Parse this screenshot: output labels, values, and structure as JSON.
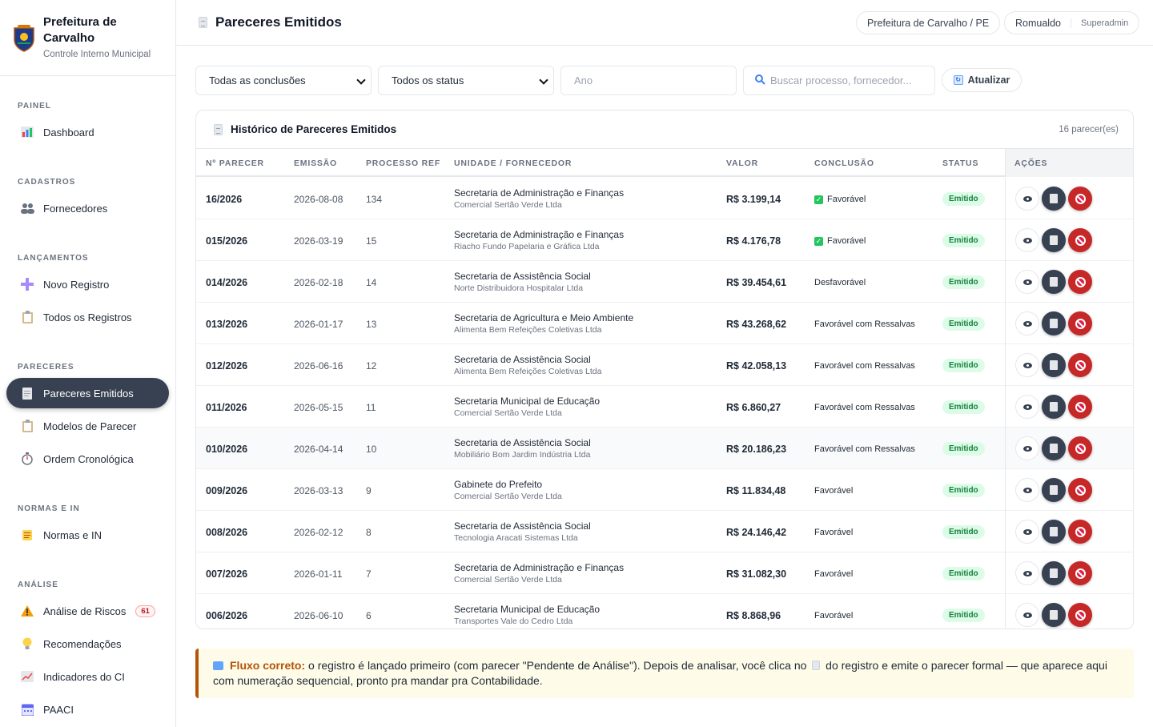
{
  "brand": {
    "title": "Prefeitura de Carvalho",
    "subtitle": "Controle Interno Municipal"
  },
  "sidebar": {
    "sections": [
      {
        "label": "PAINEL"
      },
      {
        "label": "CADASTROS"
      },
      {
        "label": "LANÇAMENTOS"
      },
      {
        "label": "PARECERES"
      },
      {
        "label": "NORMAS E IN"
      },
      {
        "label": "ANÁLISE"
      }
    ],
    "items": [
      {
        "label": "Dashboard",
        "icon": "bar-chart-icon"
      },
      {
        "label": "Fornecedores",
        "icon": "users-icon"
      },
      {
        "label": "Novo Registro",
        "icon": "plus-icon"
      },
      {
        "label": "Todos os Registros",
        "icon": "clipboard-icon"
      },
      {
        "label": "Pareceres Emitidos",
        "icon": "document-icon",
        "active": true
      },
      {
        "label": "Modelos de Parecer",
        "icon": "clipboard-icon"
      },
      {
        "label": "Ordem Cronológica",
        "icon": "stopwatch-icon"
      },
      {
        "label": "Normas e IN",
        "icon": "scroll-icon"
      },
      {
        "label": "Análise de Riscos",
        "icon": "warning-icon",
        "badge": "61"
      },
      {
        "label": "Recomendações",
        "icon": "lightbulb-icon"
      },
      {
        "label": "Indicadores do CI",
        "icon": "trend-chart-icon"
      },
      {
        "label": "PAACI",
        "icon": "calendar-icon"
      }
    ]
  },
  "header": {
    "title": "Pareceres Emitidos",
    "org": "Prefeitura de Carvalho / PE",
    "user": "Romualdo",
    "role": "Superadmin"
  },
  "filters": {
    "conclusion": "Todas as conclusões",
    "status": "Todos os status",
    "year_placeholder": "Ano",
    "search_placeholder": "Buscar processo, fornecedor...",
    "refresh_label": "Atualizar"
  },
  "table": {
    "title": "Histórico de Pareceres Emitidos",
    "count": "16 parecer(es)",
    "columns": [
      "Nº PARECER",
      "EMISSÃO",
      "PROCESSO REF",
      "UNIDADE / FORNECEDOR",
      "VALOR",
      "CONCLUSÃO",
      "STATUS",
      "AÇÕES"
    ],
    "rows": [
      {
        "numero": "16/2026",
        "emissao": "2026-08-08",
        "processo": "134",
        "unidade": "Secretaria de Administração e Finanças",
        "fornecedor": "Comercial Sertão Verde Ltda",
        "valor": "R$ 3.199,14",
        "conclusao": "Favorável",
        "check": true,
        "status": "Emitido"
      },
      {
        "numero": "015/2026",
        "emissao": "2026-03-19",
        "processo": "15",
        "unidade": "Secretaria de Administração e Finanças",
        "fornecedor": "Riacho Fundo Papelaria e Gráfica Ltda",
        "valor": "R$ 4.176,78",
        "conclusao": "Favorável",
        "check": true,
        "status": "Emitido"
      },
      {
        "numero": "014/2026",
        "emissao": "2026-02-18",
        "processo": "14",
        "unidade": "Secretaria de Assistência Social",
        "fornecedor": "Norte Distribuidora Hospitalar Ltda",
        "valor": "R$ 39.454,61",
        "conclusao": "Desfavorável",
        "check": false,
        "status": "Emitido"
      },
      {
        "numero": "013/2026",
        "emissao": "2026-01-17",
        "processo": "13",
        "unidade": "Secretaria de Agricultura e Meio Ambiente",
        "fornecedor": "Alimenta Bem Refeições Coletivas Ltda",
        "valor": "R$ 43.268,62",
        "conclusao": "Favorável com Ressalvas",
        "check": false,
        "status": "Emitido"
      },
      {
        "numero": "012/2026",
        "emissao": "2026-06-16",
        "processo": "12",
        "unidade": "Secretaria de Assistência Social",
        "fornecedor": "Alimenta Bem Refeições Coletivas Ltda",
        "valor": "R$ 42.058,13",
        "conclusao": "Favorável com Ressalvas",
        "check": false,
        "status": "Emitido"
      },
      {
        "numero": "011/2026",
        "emissao": "2026-05-15",
        "processo": "11",
        "unidade": "Secretaria Municipal de Educação",
        "fornecedor": "Comercial Sertão Verde Ltda",
        "valor": "R$ 6.860,27",
        "conclusao": "Favorável com Ressalvas",
        "check": false,
        "status": "Emitido"
      },
      {
        "numero": "010/2026",
        "emissao": "2026-04-14",
        "processo": "10",
        "unidade": "Secretaria de Assistência Social",
        "fornecedor": "Mobiliário Bom Jardim Indústria Ltda",
        "valor": "R$ 20.186,23",
        "conclusao": "Favorável com Ressalvas",
        "check": false,
        "status": "Emitido"
      },
      {
        "numero": "009/2026",
        "emissao": "2026-03-13",
        "processo": "9",
        "unidade": "Gabinete do Prefeito",
        "fornecedor": "Comercial Sertão Verde Ltda",
        "valor": "R$ 11.834,48",
        "conclusao": "Favorável",
        "check": false,
        "status": "Emitido"
      },
      {
        "numero": "008/2026",
        "emissao": "2026-02-12",
        "processo": "8",
        "unidade": "Secretaria de Assistência Social",
        "fornecedor": "Tecnologia Aracati Sistemas Ltda",
        "valor": "R$ 24.146,42",
        "conclusao": "Favorável",
        "check": false,
        "status": "Emitido"
      },
      {
        "numero": "007/2026",
        "emissao": "2026-01-11",
        "processo": "7",
        "unidade": "Secretaria de Administração e Finanças",
        "fornecedor": "Comercial Sertão Verde Ltda",
        "valor": "R$ 31.082,30",
        "conclusao": "Favorável",
        "check": false,
        "status": "Emitido"
      },
      {
        "numero": "006/2026",
        "emissao": "2026-06-10",
        "processo": "6",
        "unidade": "Secretaria Municipal de Educação",
        "fornecedor": "Transportes Vale do Cedro Ltda",
        "valor": "R$ 8.868,96",
        "conclusao": "Favorável",
        "check": false,
        "status": "Emitido"
      }
    ]
  },
  "note": {
    "lead": "Fluxo correto:",
    "part1": " o registro é lançado primeiro (com parecer \"Pendente de Análise\"). Depois de analisar, você clica no ",
    "part2": " do registro e emite o parecer formal — que aparece aqui com numeração sequencial, pronto pra mandar pra Contabilidade."
  },
  "colors": {
    "accent": "#374151",
    "danger": "#c62828",
    "success": "#15803d",
    "note_border": "#b45309"
  }
}
